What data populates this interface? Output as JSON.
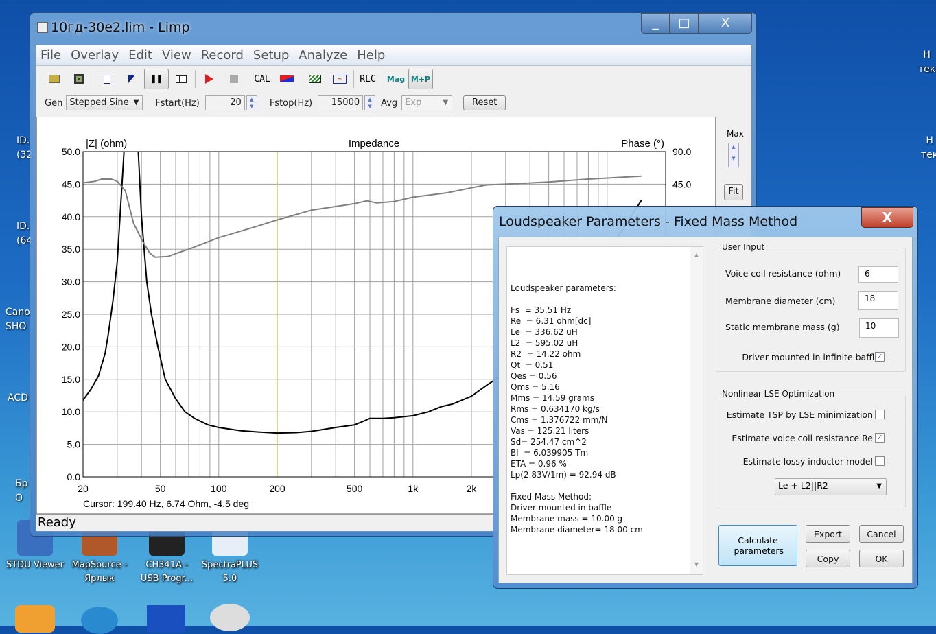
{
  "desktop": {
    "icons": [
      {
        "label": "STDU Viewer",
        "color": "#3a6fc0"
      },
      {
        "label": "MapSource - Ярлык",
        "color": "#b0582a"
      },
      {
        "label": "CH341A - USB Progr...",
        "color": "#222222"
      },
      {
        "label": "SpectraPLUS 5.0",
        "color": "#e8eef8"
      }
    ],
    "partial_left": [
      "ID.",
      "(32",
      "ID.",
      "(64",
      "Cano",
      "SHO",
      "ACD",
      "Бр",
      "О"
    ],
    "partial_right": [
      "Н",
      "тек",
      "Н",
      "тек"
    ]
  },
  "window": {
    "title": "10гд-30е2.lim - Limp",
    "minimize": "_",
    "maximize": "□",
    "close": "X"
  },
  "menu": [
    "File",
    "Overlay",
    "Edit",
    "View",
    "Record",
    "Setup",
    "Analyze",
    "Help"
  ],
  "toolbar": {
    "cal": "CAL",
    "rlc": "RLC",
    "mag": "Mag",
    "mp": "M+P"
  },
  "params": {
    "gen_label": "Gen",
    "gen_value": "Stepped Sine",
    "fstart_label": "Fstart(Hz)",
    "fstart_value": "20",
    "fstop_label": "Fstop(Hz)",
    "fstop_value": "15000",
    "avg_label": "Avg",
    "avg_value": "Exp",
    "reset": "Reset"
  },
  "side": {
    "max": "Max",
    "fit": "Fit"
  },
  "status": "Ready",
  "chart_data": {
    "type": "line",
    "title": "Impedance",
    "ylabel": "|Z| (ohm)",
    "y2label": "Phase (°)",
    "x_scale": "log",
    "xlim": [
      20,
      20000
    ],
    "ylim": [
      0,
      50
    ],
    "y2lim": [
      -360,
      90
    ],
    "x_ticks": [
      "20",
      "50",
      "100",
      "200",
      "500",
      "1k",
      "2k"
    ],
    "x_tick_values": [
      20,
      50,
      100,
      200,
      500,
      1000,
      2000
    ],
    "y_ticks": [
      "0.0",
      "5.0",
      "10.0",
      "15.0",
      "20.0",
      "25.0",
      "30.0",
      "35.0",
      "40.0",
      "45.0",
      "50.0"
    ],
    "y2_ticks": [
      "90.0",
      "45.0"
    ],
    "grid": true,
    "cursor": {
      "freq": 199.4,
      "text": "Cursor: 199.40 Hz, 6.74 Ohm, -4.5 deg",
      "color": "#b8b040"
    },
    "series": [
      {
        "axis": "left",
        "color": "#000000",
        "points": [
          [
            20,
            11.8
          ],
          [
            22,
            13.5
          ],
          [
            24,
            15.5
          ],
          [
            26,
            19
          ],
          [
            27,
            22
          ],
          [
            28.5,
            27
          ],
          [
            30,
            33
          ],
          [
            31,
            40
          ],
          [
            32.5,
            50
          ],
          [
            34,
            70
          ],
          [
            35.5,
            80
          ],
          [
            37,
            70
          ],
          [
            38.5,
            50
          ],
          [
            40,
            40
          ],
          [
            42.6,
            30
          ],
          [
            45,
            25
          ],
          [
            48.6,
            20
          ],
          [
            53,
            15
          ],
          [
            60,
            12
          ],
          [
            67,
            10
          ],
          [
            75,
            9
          ],
          [
            88,
            8
          ],
          [
            100,
            7.6
          ],
          [
            130,
            7.1
          ],
          [
            160,
            6.9
          ],
          [
            200,
            6.74
          ],
          [
            250,
            6.8
          ],
          [
            300,
            7.0
          ],
          [
            400,
            7.6
          ],
          [
            500,
            8.0
          ],
          [
            560,
            8.6
          ],
          [
            600,
            9.0
          ],
          [
            700,
            9.0
          ],
          [
            800,
            9.1
          ],
          [
            1000,
            9.4
          ],
          [
            1200,
            10
          ],
          [
            1400,
            10.8
          ],
          [
            1600,
            11.2
          ],
          [
            2000,
            12.4
          ],
          [
            2400,
            14.1
          ],
          [
            3000,
            16
          ],
          [
            5000,
            22
          ],
          [
            8000,
            30
          ],
          [
            12000,
            38
          ],
          [
            15000,
            42.5
          ]
        ]
      },
      {
        "axis": "right",
        "color": "#808080",
        "points": [
          [
            20,
            46.8
          ],
          [
            23,
            49
          ],
          [
            25,
            52
          ],
          [
            28,
            52
          ],
          [
            30,
            49
          ],
          [
            33,
            36
          ],
          [
            36.4,
            -9
          ],
          [
            40,
            -31
          ],
          [
            44,
            -50
          ],
          [
            47,
            -56
          ],
          [
            55,
            -55
          ],
          [
            60,
            -51
          ],
          [
            70,
            -45
          ],
          [
            100,
            -29
          ],
          [
            150,
            -15
          ],
          [
            200,
            -4.5
          ],
          [
            300,
            9
          ],
          [
            500,
            18
          ],
          [
            580,
            22
          ],
          [
            650,
            19
          ],
          [
            800,
            21
          ],
          [
            1000,
            27
          ],
          [
            1500,
            33
          ],
          [
            2000,
            40
          ],
          [
            2400,
            44
          ],
          [
            3000,
            45
          ],
          [
            5000,
            48
          ],
          [
            8000,
            52
          ],
          [
            15000,
            56
          ]
        ]
      }
    ]
  },
  "dialog": {
    "title": "Loudspeaker Parameters - Fixed Mass Method",
    "close": "X",
    "results": [
      "Loudspeaker parameters:",
      "",
      "Fs  = 35.51 Hz",
      "Re  = 6.31 ohm[dc]",
      "Le  = 336.62 uH",
      "L2  = 595.02 uH",
      "R2  = 14.22 ohm",
      "Qt  = 0.51",
      "Qes = 0.56",
      "Qms = 5.16",
      "Mms = 14.59 grams",
      "Rms = 0.634170 kg/s",
      "Cms = 1.376722 mm/N",
      "Vas = 125.21 liters",
      "Sd= 254.47 cm^2",
      "Bl  = 6.039905 Tm",
      "ETA = 0.96 %",
      "Lp(2.83V/1m) = 92.94 dB",
      "",
      "Fixed Mass Method:",
      "Driver mounted in baffle",
      "Membrane mass = 10.00 g",
      "Membrane diameter= 18.00 cm"
    ],
    "user_input": {
      "title": "User Input",
      "vc_label": "Voice coil resistance (ohm)",
      "vc_value": "6",
      "diam_label": "Membrane diameter (cm)",
      "diam_value": "18",
      "mass_label": "Static membrane mass (g)",
      "mass_value": "10",
      "baffle_label": "Driver mounted in infinite baffle",
      "baffle_checked": true
    },
    "lse": {
      "title": "Nonlinear LSE Optimization",
      "tsp_label": "Estimate TSP by LSE minimization",
      "tsp_checked": false,
      "re_label": "Estimate voice coil resistance Re",
      "re_checked": true,
      "lossy_label": "Estimate lossy inductor model",
      "lossy_checked": false,
      "model_value": "Le + L2||R2"
    },
    "buttons": {
      "calculate": "Calculate parameters",
      "export": "Export",
      "cancel": "Cancel",
      "copy": "Copy",
      "ok": "OK"
    },
    "check_mark": "✓"
  }
}
